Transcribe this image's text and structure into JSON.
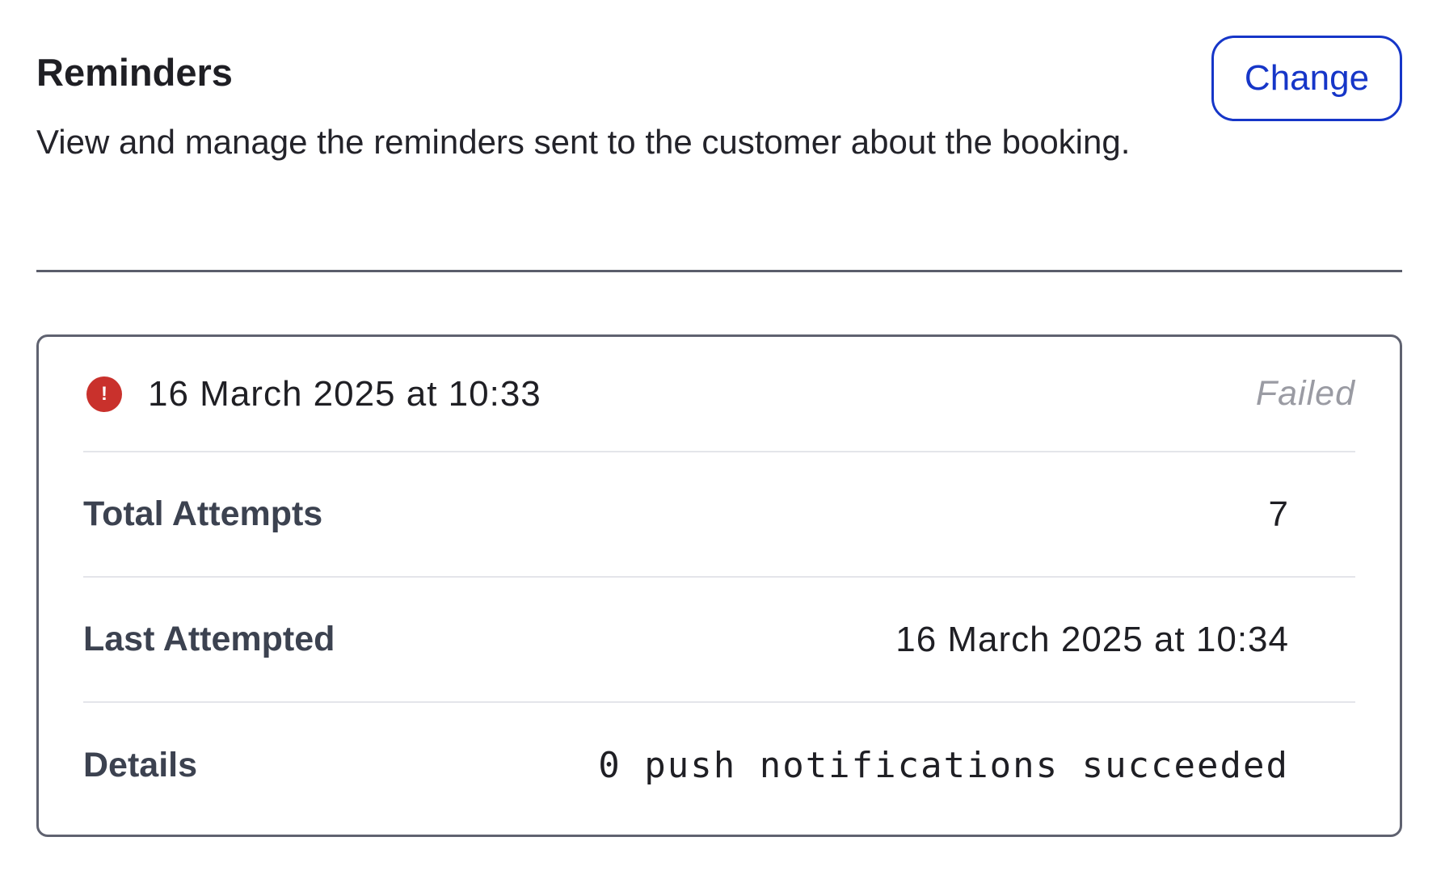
{
  "reminders": {
    "title": "Reminders",
    "description": "View and manage the reminders sent to the customer about the booking.",
    "change_button_label": "Change"
  },
  "reminder_entry": {
    "status_icon": "error-exclamation-icon",
    "status_icon_glyph": "!",
    "status_color": "#c9312c",
    "scheduled_at": "16 March 2025 at 10:33",
    "status": "Failed",
    "rows": [
      {
        "label": "Total Attempts",
        "value": "7"
      },
      {
        "label": "Last Attempted",
        "value": "16 March 2025 at 10:34"
      },
      {
        "label": "Details",
        "value": "0 push notifications succeeded"
      }
    ]
  },
  "colors": {
    "accent": "#1636c8",
    "error": "#c9312c",
    "muted_text": "#9a9ba3"
  }
}
